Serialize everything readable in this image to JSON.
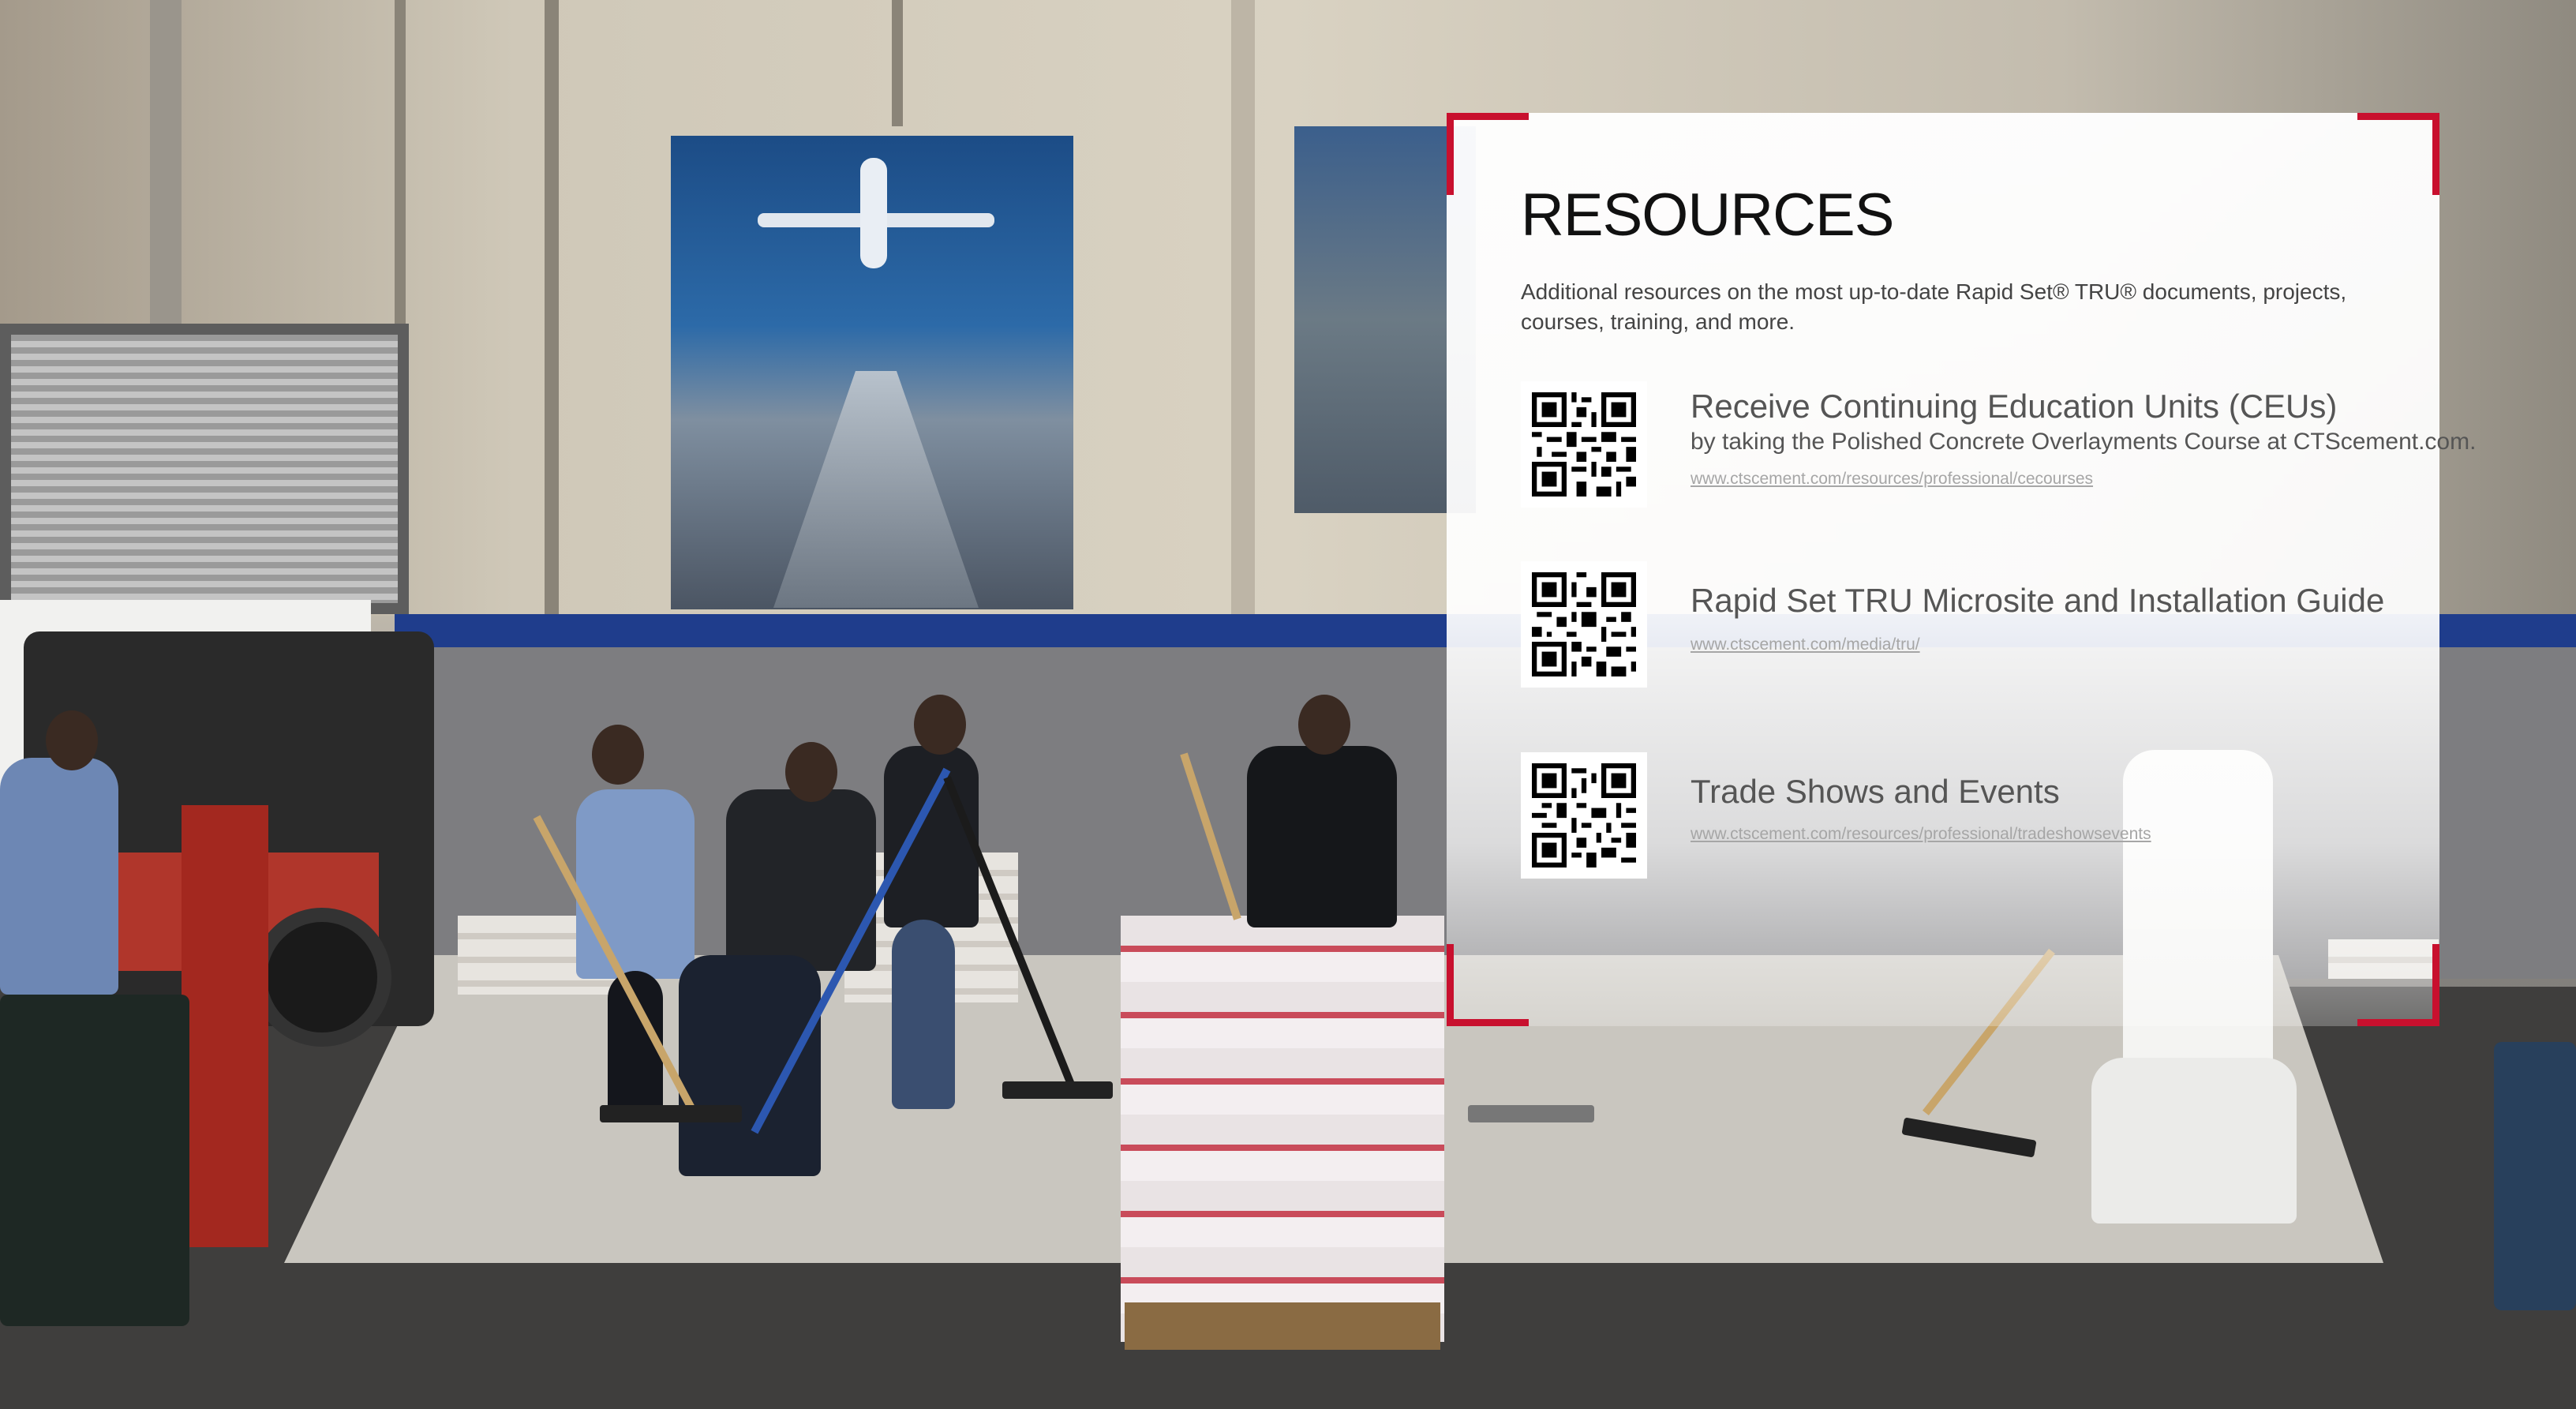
{
  "resources": {
    "title": "RESOURCES",
    "intro": "Additional resources on the most up-to-date Rapid Set® TRU® documents, projects, courses, training, and more.",
    "items": [
      {
        "title": "Receive Continuing Education Units (CEUs)",
        "description": "by taking the Polished Concrete Overlayments Course at CTScement.com.",
        "url": "www.ctscement.com/resources/professional/cecourses",
        "icon": "qr-code-icon"
      },
      {
        "title": "Rapid Set TRU Microsite and Installation Guide",
        "description": "",
        "url": "www.ctscement.com/media/tru/",
        "icon": "qr-code-icon"
      },
      {
        "title": "Trade Shows and Events",
        "description": "",
        "url": "www.ctscement.com/resources/professional/tradeshowsevents",
        "icon": "qr-code-icon"
      }
    ]
  },
  "colors": {
    "accent": "#c8102e",
    "heading": "#111111",
    "body_text": "#555555",
    "link": "#a6a6a6"
  }
}
